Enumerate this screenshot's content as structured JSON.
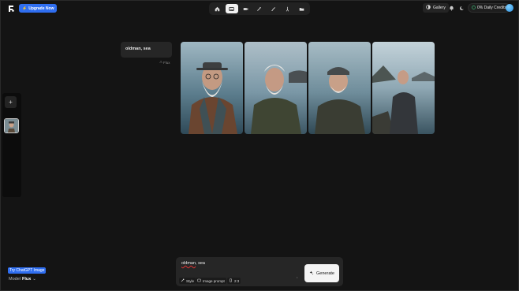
{
  "topbar": {
    "logo": "freepik-logo-icon",
    "upgrade_label": "Upgrade Now",
    "gallery_label": "Gallery",
    "credits_label": "0% Daily Credits"
  },
  "nav_tools": [
    {
      "name": "home-icon",
      "active": false
    },
    {
      "name": "image-icon",
      "active": true
    },
    {
      "name": "video-icon",
      "active": false
    },
    {
      "name": "magic-wand-icon",
      "active": false
    },
    {
      "name": "brush-icon",
      "active": false
    },
    {
      "name": "pin-icon",
      "active": false
    },
    {
      "name": "folder-icon",
      "active": false
    }
  ],
  "history": {
    "prompt": "oldman, sea",
    "model_tag": "Flux"
  },
  "colors": {
    "accent": "#2f6ef0",
    "background": "#141414",
    "panel": "#262626"
  },
  "composer": {
    "prompt_word1": "oldman",
    "prompt_rest": ", sea",
    "style_label": "Style",
    "image_prompt_label": "Image prompt",
    "ratio_label": "2:3",
    "generate_label": "Generate"
  },
  "footer": {
    "try_label": "Try ChatGPT Image",
    "model_prefix": "Model",
    "model_name": "Flux"
  }
}
